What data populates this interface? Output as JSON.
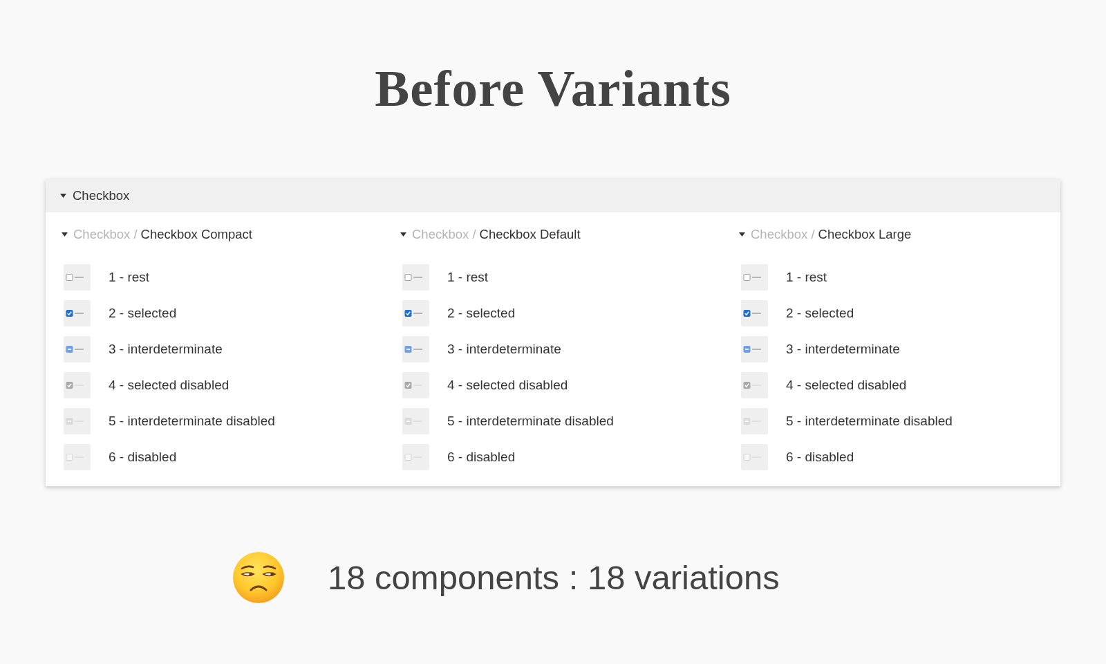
{
  "title": "Before Variants",
  "panel": {
    "title": "Checkbox",
    "expanded": true,
    "groups": [
      {
        "parent": "Checkbox /",
        "name": "Checkbox Compact",
        "expanded": true,
        "items": [
          {
            "label": "1 - rest",
            "checked": false,
            "mixed": false,
            "disabled": false
          },
          {
            "label": "2 - selected",
            "checked": true,
            "mixed": false,
            "disabled": false
          },
          {
            "label": "3 - interdeterminate",
            "checked": false,
            "mixed": true,
            "disabled": false
          },
          {
            "label": "4 - selected disabled",
            "checked": true,
            "mixed": false,
            "disabled": true
          },
          {
            "label": "5 - interdeterminate disabled",
            "checked": false,
            "mixed": true,
            "disabled": true
          },
          {
            "label": "6 - disabled",
            "checked": false,
            "mixed": false,
            "disabled": true
          }
        ]
      },
      {
        "parent": "Checkbox /",
        "name": "Checkbox Default",
        "expanded": true,
        "items": [
          {
            "label": "1 - rest",
            "checked": false,
            "mixed": false,
            "disabled": false
          },
          {
            "label": "2 - selected",
            "checked": true,
            "mixed": false,
            "disabled": false
          },
          {
            "label": "3 - interdeterminate",
            "checked": false,
            "mixed": true,
            "disabled": false
          },
          {
            "label": "4 - selected disabled",
            "checked": true,
            "mixed": false,
            "disabled": true
          },
          {
            "label": "5 - interdeterminate disabled",
            "checked": false,
            "mixed": true,
            "disabled": true
          },
          {
            "label": "6 - disabled",
            "checked": false,
            "mixed": false,
            "disabled": true
          }
        ]
      },
      {
        "parent": "Checkbox /",
        "name": "Checkbox Large",
        "expanded": true,
        "items": [
          {
            "label": "1 - rest",
            "checked": false,
            "mixed": false,
            "disabled": false
          },
          {
            "label": "2 - selected",
            "checked": true,
            "mixed": false,
            "disabled": false
          },
          {
            "label": "3 - interdeterminate",
            "checked": false,
            "mixed": true,
            "disabled": false
          },
          {
            "label": "4 - selected disabled",
            "checked": true,
            "mixed": false,
            "disabled": true
          },
          {
            "label": "5 - interdeterminate disabled",
            "checked": false,
            "mixed": true,
            "disabled": true
          },
          {
            "label": "6 - disabled",
            "checked": false,
            "mixed": false,
            "disabled": true
          }
        ]
      }
    ]
  },
  "footer": {
    "text": "18 components : 18 variations"
  }
}
